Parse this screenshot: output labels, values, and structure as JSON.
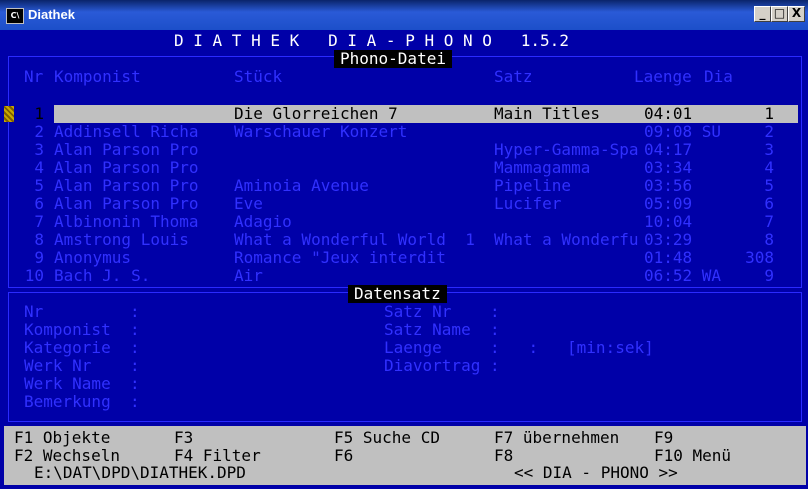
{
  "window": {
    "title": "Diathek",
    "icon_text": "C\\",
    "controls": [
      "_",
      "□",
      "X"
    ]
  },
  "header": {
    "app_title": "D I A T H E K   D I A - P H O N O   1.5.2"
  },
  "phono_panel": {
    "label": "Phono-Datei",
    "columns": [
      "Nr",
      "Komponist",
      "Stück",
      "Satz",
      "Laenge",
      "Dia"
    ],
    "rows": [
      {
        "nr": "1",
        "komponist": "",
        "stueck": "Die Glorreichen 7",
        "satz": "Main Titles",
        "laenge": "04:01",
        "dia": "1"
      },
      {
        "nr": "2",
        "komponist": "Addinsell Richa",
        "stueck": "Warschauer Konzert",
        "satz": "",
        "laenge": "09:08 SU",
        "dia": "2"
      },
      {
        "nr": "3",
        "komponist": "Alan Parson Pro",
        "stueck": "",
        "satz": "Hyper-Gamma-Spa",
        "laenge": "04:17",
        "dia": "3"
      },
      {
        "nr": "4",
        "komponist": "Alan Parson Pro",
        "stueck": "",
        "satz": "Mammagamma",
        "laenge": "03:34",
        "dia": "4"
      },
      {
        "nr": "5",
        "komponist": "Alan Parson Pro",
        "stueck": "Aminoia Avenue",
        "satz": "Pipeline",
        "laenge": "03:56",
        "dia": "5"
      },
      {
        "nr": "6",
        "komponist": "Alan Parson Pro",
        "stueck": "Eve",
        "satz": "Lucifer",
        "laenge": "05:09",
        "dia": "6"
      },
      {
        "nr": "7",
        "komponist": "Albinonin Thoma",
        "stueck": "Adagio",
        "satz": "",
        "laenge": "10:04",
        "dia": "7"
      },
      {
        "nr": "8",
        "komponist": "Amstrong Louis",
        "stueck": "What a Wonderful World  1",
        "satz": "What a Wonderfu",
        "laenge": "03:29",
        "dia": "8"
      },
      {
        "nr": "9",
        "komponist": "Anonymus",
        "stueck": "Romance \"Jeux interdit",
        "satz": "",
        "laenge": "01:48",
        "dia": "308"
      },
      {
        "nr": "10",
        "komponist": "Bach J. S.",
        "stueck": "Air",
        "satz": "",
        "laenge": "06:52 WA",
        "dia": "9"
      }
    ]
  },
  "datensatz_panel": {
    "label": "Datensatz",
    "left_fields": [
      "Nr         :",
      "Komponist  :",
      "Kategorie  :",
      "Werk Nr    :",
      "Werk Name  :",
      "Bemerkung  :"
    ],
    "right_fields": [
      "Satz Nr    :",
      "Satz Name  :",
      "Laenge     :   :   [min:sek]",
      "Diavortrag :"
    ]
  },
  "fkeys": {
    "f1": "F1 Objekte",
    "f2": "F2 Wechseln",
    "f3": "F3",
    "f4": "F4 Filter",
    "f5": "F5 Suche CD",
    "f6": "F6",
    "f7": "F7 übernehmen",
    "f8": "F8",
    "f9": "F9",
    "f10": "F10 Menü",
    "path": "E:\\DAT\\DPD\\DIATHEK.DPD",
    "mode": "<< DIA - PHONO >>"
  }
}
